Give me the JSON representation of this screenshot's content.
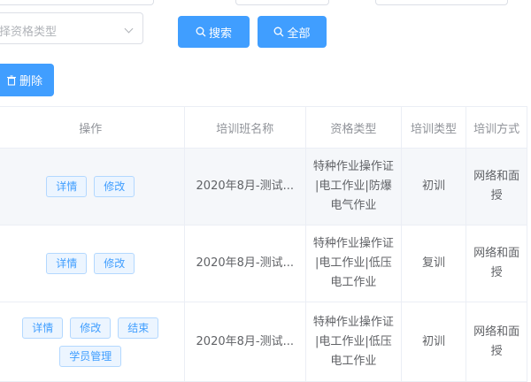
{
  "filters": {
    "qualification_placeholder": "择资格类型"
  },
  "buttons": {
    "search": "搜索",
    "all": "全部",
    "delete": "删除"
  },
  "table": {
    "headers": [
      "操作",
      "培训班名称",
      "资格类型",
      "培训类型",
      "培训方式"
    ],
    "rows": [
      {
        "actions": [
          "详情",
          "修改"
        ],
        "name": "2020年8月-测试...",
        "qualification": [
          "特种作业操作证",
          "|电工作业|防爆",
          "电气作业"
        ],
        "train_type": "初训",
        "method": [
          "网络和面",
          "授"
        ]
      },
      {
        "actions": [
          "详情",
          "修改"
        ],
        "name": "2020年8月-测试...",
        "qualification": [
          "特种作业操作证",
          "|电工作业|低压",
          "电工作业"
        ],
        "train_type": "复训",
        "method": [
          "网络和面",
          "授"
        ]
      },
      {
        "actions": [
          "详情",
          "修改",
          "结束"
        ],
        "actions_second_line": "学员管理",
        "name": "2020年8月-测试...",
        "qualification": [
          "特种作业操作证",
          "|电工作业|低压",
          "电工作业"
        ],
        "train_type": "初训",
        "method": [
          "网络和面",
          "授"
        ]
      }
    ]
  }
}
